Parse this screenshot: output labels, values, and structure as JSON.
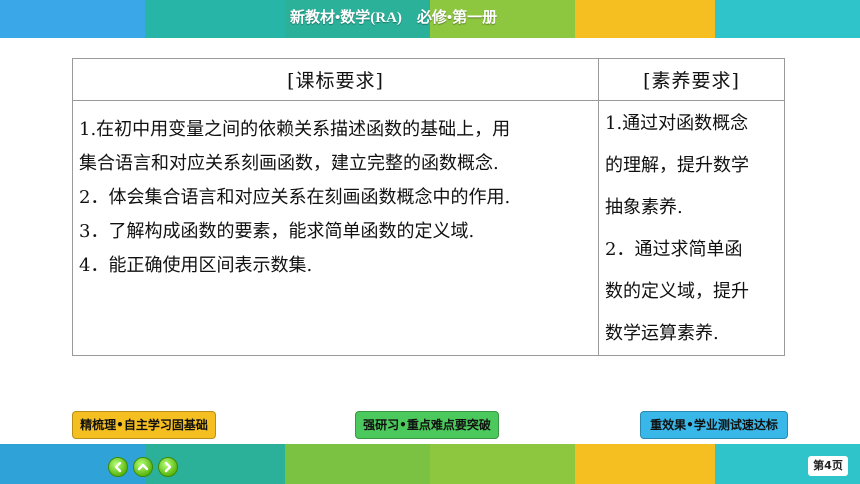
{
  "header": {
    "title": "新教材•数学(RA)　必修•第一册",
    "colors": [
      "#3aa7e8",
      "#27b5a8",
      "#8dc63f",
      "#f5bf22",
      "#f5a623",
      "#2fc4c9"
    ]
  },
  "table": {
    "left_header": "[课标要求]",
    "right_header": "[素养要求]",
    "left_lines": [
      "1.在初中用变量之间的依赖关系描述函数的基础上，用",
      "集合语言和对应关系刻画函数，建立完整的函数概念.",
      "2．体会集合语言和对应关系在刻画函数概念中的作用.",
      "3．了解构成函数的要素，能求简单函数的定义域.",
      "4．能正确使用区间表示数集."
    ],
    "right_lines": [
      "1.通过对函数概念",
      "的理解，提升数学",
      "抽象素养.",
      "2．通过求简单函",
      "数的定义域，提升",
      "数学运算素养."
    ]
  },
  "nav": {
    "btn1": "精梳理•自主学习固基础",
    "btn2": "强研习•重点难点要突破",
    "btn3": "重效果•学业测试速达标",
    "btn1_color": "#f5bf22",
    "btn2_color": "#4cc95c",
    "btn3_color": "#38b7e8"
  },
  "footer": {
    "page": "第4页",
    "icons": [
      "arrow-left-icon",
      "home-up-icon",
      "arrow-right-icon"
    ]
  }
}
